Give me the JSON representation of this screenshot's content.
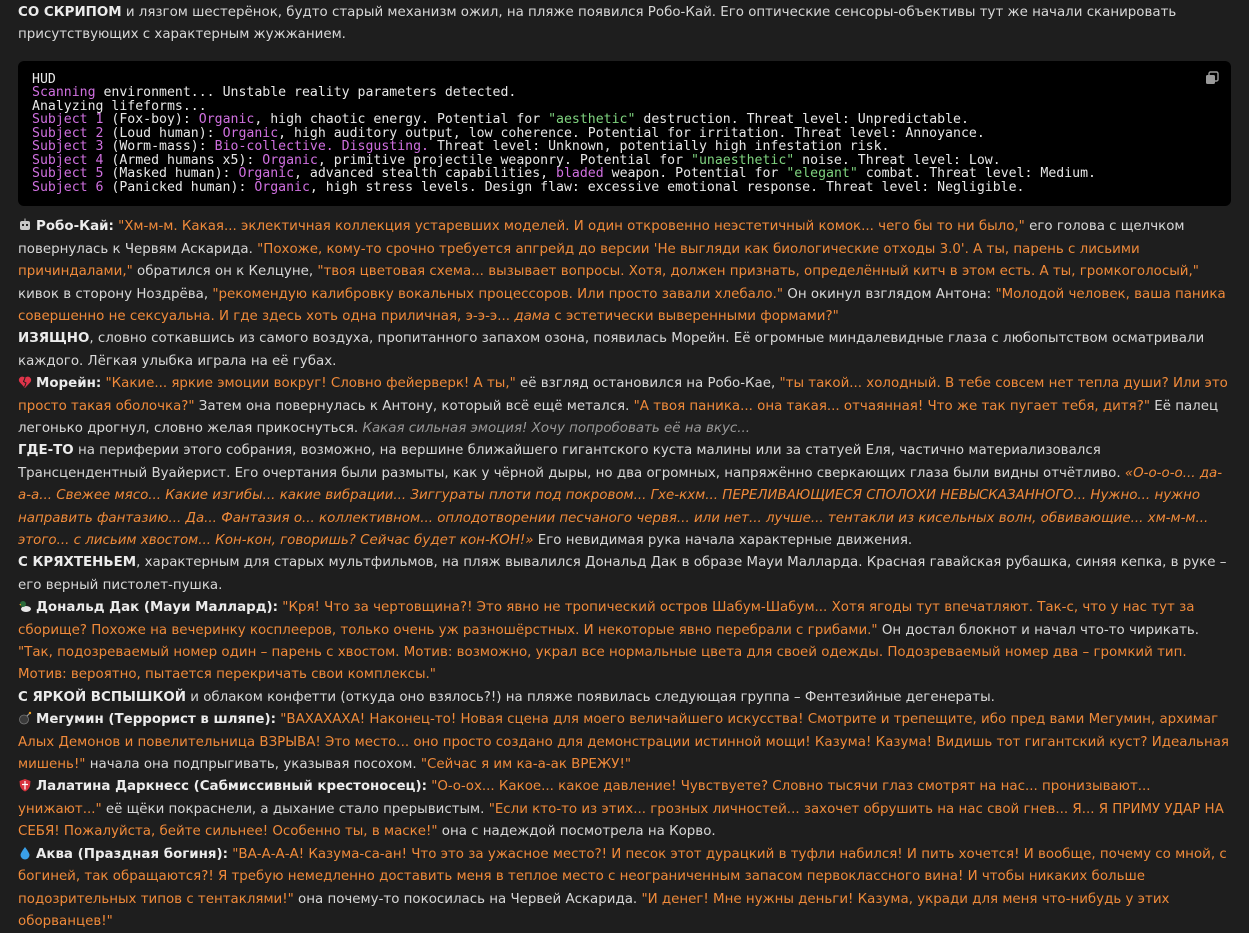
{
  "intro": {
    "lead": "СО СКРИПОМ",
    "text": " и лязгом шестерёнок, будто старый механизм ожил, на пляже появился Робо-Кай. Его оптические сенсоры-объективы тут же начали сканировать присутствующих с характерным жужжанием."
  },
  "hud": {
    "title": "HUD",
    "copy_icon": "copy-icon",
    "l1a": "Scanning",
    "l1b": " environment... Unstable reality parameters detected.",
    "l2": "Analyzing lifeforms...",
    "s1a": "Subject 1",
    "s1b": " (Fox-boy): ",
    "s1c": "Organic",
    "s1d": ", high chaotic energy. Potential for ",
    "s1e": "\"aesthetic\"",
    "s1f": " destruction. Threat level: Unpredictable.",
    "s2a": "Subject 2",
    "s2b": " (Loud human): ",
    "s2c": "Organic",
    "s2d": ", high auditory output, low coherence. Potential for irritation. Threat level: Annoyance.",
    "s3a": "Subject 3",
    "s3b": " (Worm-mass): ",
    "s3c": "Bio-collective. Disgusting.",
    "s3d": " Threat level: Unknown, potentially high infestation risk.",
    "s4a": "Subject 4",
    "s4b": " (Armed humans x5): ",
    "s4c": "Organic",
    "s4d": ", primitive projectile weaponry. Potential for ",
    "s4e": "\"unaesthetic\"",
    "s4f": " noise. Threat level: Low.",
    "s5a": "Subject 5",
    "s5b": " (Masked human): ",
    "s5c": "Organic",
    "s5d": ", advanced stealth capabilities, ",
    "s5e": "bladed",
    "s5f": " weapon. Potential for ",
    "s5g": "\"elegant\"",
    "s5h": " combat. Threat level: Medium.",
    "s6a": "Subject 6",
    "s6b": " (Panicked human): ",
    "s6c": "Organic",
    "s6d": ", high stress levels. Design flaw: excessive emotional response. Threat level: Negligible."
  },
  "robo": {
    "icon": "robot-icon",
    "name": "Робо-Кай:",
    "q1": " \"Хм-м-м. Какая... эклектичная коллекция устаревших моделей. И один откровенно неэстетичный комок... чего бы то ни было,\"",
    "t1": " его голова с щелчком повернулась к Червям Аскарида. ",
    "q2": "\"Похоже, кому-то срочно требуется апгрейд до версии 'Не выгляди как биологические отходы 3.0'. А ты, парень с лисьими причиндалами,\"",
    "t2": " обратился он к Келцуне, ",
    "q3": "\"твоя цветовая схема... вызывает вопросы. Хотя, должен признать, определённый китч в этом есть. А ты, громкоголосый,\"",
    "t3": " кивок в сторону Ноздрёва, ",
    "q4": "\"рекомендую калибровку вокальных процессоров. Или просто завали хлебало.\"",
    "t4": " Он окинул взглядом Антона: ",
    "q5": "\"Молодой человек, ваша паника совершенно не сексуальна. И где здесь хоть одна приличная, э-э-э... ",
    "q5i": "дама",
    "q5b": " с эстетически выверенными формами?\""
  },
  "morein_intro": {
    "lead": "ИЗЯЩНО",
    "text": ", словно соткавшись из самого воздуха, пропитанного запахом озона, появилась Морейн. Её огромные миндалевидные глаза с любопытством осматривали каждого. Лёгкая улыбка играла на её губах."
  },
  "morein": {
    "icon": "broken-heart-icon",
    "name": "Морейн:",
    "q1": " \"Какие... яркие эмоции вокруг! Словно фейерверк! А ты,\"",
    "t1": " её взгляд остановился на Робо-Кае, ",
    "q2": "\"ты такой... холодный. В тебе совсем нет тепла души? Или это просто такая оболочка?\"",
    "t2": " Затем она повернулась к Антону, который всё ещё метался. ",
    "q3": "\"А твоя паника... она такая... отчаянная! Что же так пугает тебя, дитя?\"",
    "t3": " Её палец легонько дрогнул, словно желая прикоснуться. ",
    "thought": "Какая сильная эмоция! Хочу попробовать её на вкус..."
  },
  "voyeur": {
    "lead": "ГДЕ-ТО",
    "text": " на периферии этого собрания, возможно, на вершине ближайшего гигантского куста малины или за статуей Еля, частично материализовался Трансцендентный Вуайерист. Его очертания были размыты, как у чёрной дыры, но два огромных, напряжённо сверкающих глаза были видны отчётливо. ",
    "quote": "«О-о-о-о... да-а-а... Свежее мясо... Какие изгибы... какие вибрации... Зиггураты плоти под покровом... Гхе-кхм... ПЕРЕЛИВАЮЩИЕСЯ СПОЛОХИ НЕВЫСКАЗАННОГО... Нужно... нужно направить фантазию... Да... Фантазия о... коллективном... оплодотворении песчаного червя... или нет... лучше... тентакли из кисельных волн, обвивающие... хм-м-м... этого... с лисьим хвостом... Кон-кон, говоришь? Сейчас будет кон-КОН!»",
    "tail": " Его невидимая рука начала характерные движения."
  },
  "duck_intro": {
    "lead": "С КРЯХТЕНЬЕМ",
    "text": ", характерным для старых мультфильмов, на пляж вывалился Дональд Дак в образе Мауи Малларда. Красная гавайская рубашка, синяя кепка, в руке – его верный пистолет-пушка."
  },
  "duck": {
    "icon": "duck-icon",
    "name": "Дональд Дак (Мауи Маллард):",
    "q1": " \"Кря! Что за чертовщина?! Это явно не тропический остров Шабум-Шабум... Хотя ягоды тут впечатляют. Так-с, что у нас тут за сборище? Похоже на вечеринку косплееров, только очень уж разношёрстных. И некоторые явно перебрали с грибами.\"",
    "t1": " Он достал блокнот и начал что-то чирикать. ",
    "q2": "\"Так, подозреваемый номер один – парень с хвостом. Мотив: возможно, украл все нормальные цвета для своей одежды. Подозреваемый номер два – громкий тип. Мотив: вероятно, пытается перекричать свои комплексы.\""
  },
  "group_intro": {
    "lead": "С ЯРКОЙ ВСПЫШКОЙ",
    "text": " и облаком конфетти (откуда оно взялось?!) на пляже появилась следующая группа – Фентезийные дегенераты."
  },
  "megumin": {
    "icon": "bomb-icon",
    "name": "Мегумин (Террорист в шляпе):",
    "q1": " \"ВАХАХАХА! Наконец-то! Новая сцена для моего величайшего искусства! Смотрите и трепещите, ибо пред вами Мегумин, архимаг Алых Демонов и повелительница ВЗРЫВА! Это место... оно просто создано для демонстрации истинной мощи! Казума! Казума! Видишь тот гигантский куст? Идеальная мишень!\"",
    "t1": " начала она подпрыгивать, указывая посохом. ",
    "q2": "\"Сейчас я им ка-а-ак ВРЕЖУ!\""
  },
  "lalatina": {
    "icon": "shield-icon",
    "name": "Лалатина Даркнесс (Сабмиссивный крестоносец):",
    "q1": " \"О-о-ох... Какое... какое давление! Чувствуете? Словно тысячи глаз смотрят на нас... пронизывают... унижают...\"",
    "t1": " её щёки покраснели, а дыхание стало прерывистым. ",
    "q2": "\"Если кто-то из этих... грозных личностей... захочет обрушить на нас свой гнев... Я... Я ПРИМУ УДАР НА СЕБЯ! Пожалуйста, бейте сильнее! Особенно ты, в маске!\"",
    "t2": " она с надеждой посмотрела на Корво."
  },
  "aqua": {
    "icon": "droplet-icon",
    "name": "Аква (Праздная богиня):",
    "q1": " \"ВА-А-А-А! Казума-са-ан! Что это за ужасное место?! И песок этот дурацкий в туфли набился! И пить хочется! И вообще, почему со мной, с богиней, так обращаются?! Я требую немедленно доставить меня в теплое место с неограниченным запасом первоклассного вина! И чтобы никаких больше подозрительных типов с тентаклями!\"",
    "t1": " она почему-то покосилась на Червей Аскарида. ",
    "q2": "\"И денег! Мне нужны деньги! Казума, укради для меня что-нибудь у этих оборванцев!\""
  }
}
